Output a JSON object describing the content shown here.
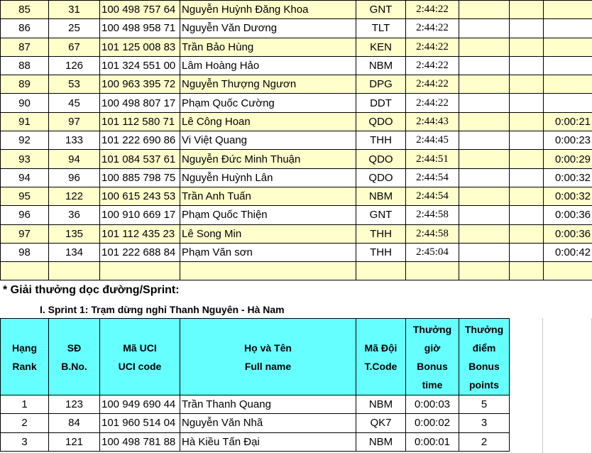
{
  "results": [
    {
      "rank": "85",
      "bib": "31",
      "uci": "100 498 757 64",
      "name": "Nguyễn Huỳnh Đăng Khoa",
      "team": "GNT",
      "time": "2:44:22",
      "gap": ""
    },
    {
      "rank": "86",
      "bib": "25",
      "uci": "100 498 958 71",
      "name": "Nguyễn Văn Dương",
      "team": "TLT",
      "time": "2:44:22",
      "gap": ""
    },
    {
      "rank": "87",
      "bib": "67",
      "uci": "101 125 008 83",
      "name": "Trần Bảo Hùng",
      "team": "KEN",
      "time": "2:44:22",
      "gap": ""
    },
    {
      "rank": "88",
      "bib": "126",
      "uci": "101 324 551 00",
      "name": "Lâm Hoàng Hảo",
      "team": "NBM",
      "time": "2:44:22",
      "gap": ""
    },
    {
      "rank": "89",
      "bib": "53",
      "uci": "100 963 395 72",
      "name": "Nguyễn Thượng Ngươn",
      "team": "DPG",
      "time": "2:44:22",
      "gap": ""
    },
    {
      "rank": "90",
      "bib": "45",
      "uci": "100 498 807 17",
      "name": "Phạm Quốc Cường",
      "team": "DDT",
      "time": "2:44:22",
      "gap": ""
    },
    {
      "rank": "91",
      "bib": "97",
      "uci": "101 112 580 71",
      "name": "Lê Công Hoan",
      "team": "QDO",
      "time": "2:44:43",
      "gap": "0:00:21"
    },
    {
      "rank": "92",
      "bib": "133",
      "uci": "101 222 690 86",
      "name": "Vi Việt Quang",
      "team": "THH",
      "time": "2:44:45",
      "gap": "0:00:23"
    },
    {
      "rank": "93",
      "bib": "94",
      "uci": "101 084 537 61",
      "name": "Nguyễn Đức Minh Thuận",
      "team": "QDO",
      "time": "2:44:51",
      "gap": "0:00:29"
    },
    {
      "rank": "94",
      "bib": "96",
      "uci": "100 885 798 75",
      "name": "Nguyễn Huỳnh Lân",
      "team": "QDO",
      "time": "2:44:54",
      "gap": "0:00:32"
    },
    {
      "rank": "95",
      "bib": "122",
      "uci": "100 615 243 53",
      "name": "Trần Anh Tuấn",
      "team": "NBM",
      "time": "2:44:54",
      "gap": "0:00:32"
    },
    {
      "rank": "96",
      "bib": "36",
      "uci": "100 910 669 17",
      "name": "Phạm Quốc Thiện",
      "team": "GNT",
      "time": "2:44:58",
      "gap": "0:00:36"
    },
    {
      "rank": "97",
      "bib": "135",
      "uci": "101 112 435 23",
      "name": "Lê Song Min",
      "team": "THH",
      "time": "2:44:58",
      "gap": "0:00:36"
    },
    {
      "rank": "98",
      "bib": "134",
      "uci": "101 222 688 84",
      "name": "Phạm Văn sơn",
      "team": "THH",
      "time": "2:45:04",
      "gap": "0:00:42"
    }
  ],
  "section_title": "* Giải thưởng dọc đường/Sprint:",
  "sprint_title": "I. Sprint 1: Trạm dừng nghỉ Thanh Nguyên - Hà Nam",
  "sprint_headers": {
    "rank": [
      "Hạng",
      "Rank"
    ],
    "bib": [
      "SĐ",
      "B.No."
    ],
    "uci": [
      "Mã UCI",
      "UCI code"
    ],
    "name": [
      "Họ và Tên",
      "Full name"
    ],
    "team": [
      "Mã Đội",
      "T.Code"
    ],
    "bonus_time": [
      "Thưởng",
      "giờ",
      "Bonus",
      "time"
    ],
    "bonus_points": [
      "Thưởng",
      "điểm",
      "Bonus",
      "points"
    ]
  },
  "sprint_rows": [
    {
      "rank": "1",
      "bib": "123",
      "uci": "100 949 690 44",
      "name": "Trần Thanh Quang",
      "team": "NBM",
      "bonus_time": "0:00:03",
      "points": "5"
    },
    {
      "rank": "2",
      "bib": "84",
      "uci": "101 960 514 04",
      "name": "Nguyễn Văn Nhã",
      "team": "QK7",
      "bonus_time": "0:00:02",
      "points": "3"
    },
    {
      "rank": "3",
      "bib": "121",
      "uci": "100 498 781 88",
      "name": "Hà Kiều Tấn Đại",
      "team": "NBM",
      "bonus_time": "0:00:01",
      "points": "2"
    }
  ],
  "colors": {
    "row_highlight": "#ffffcc",
    "header_fill": "#66ffff"
  }
}
